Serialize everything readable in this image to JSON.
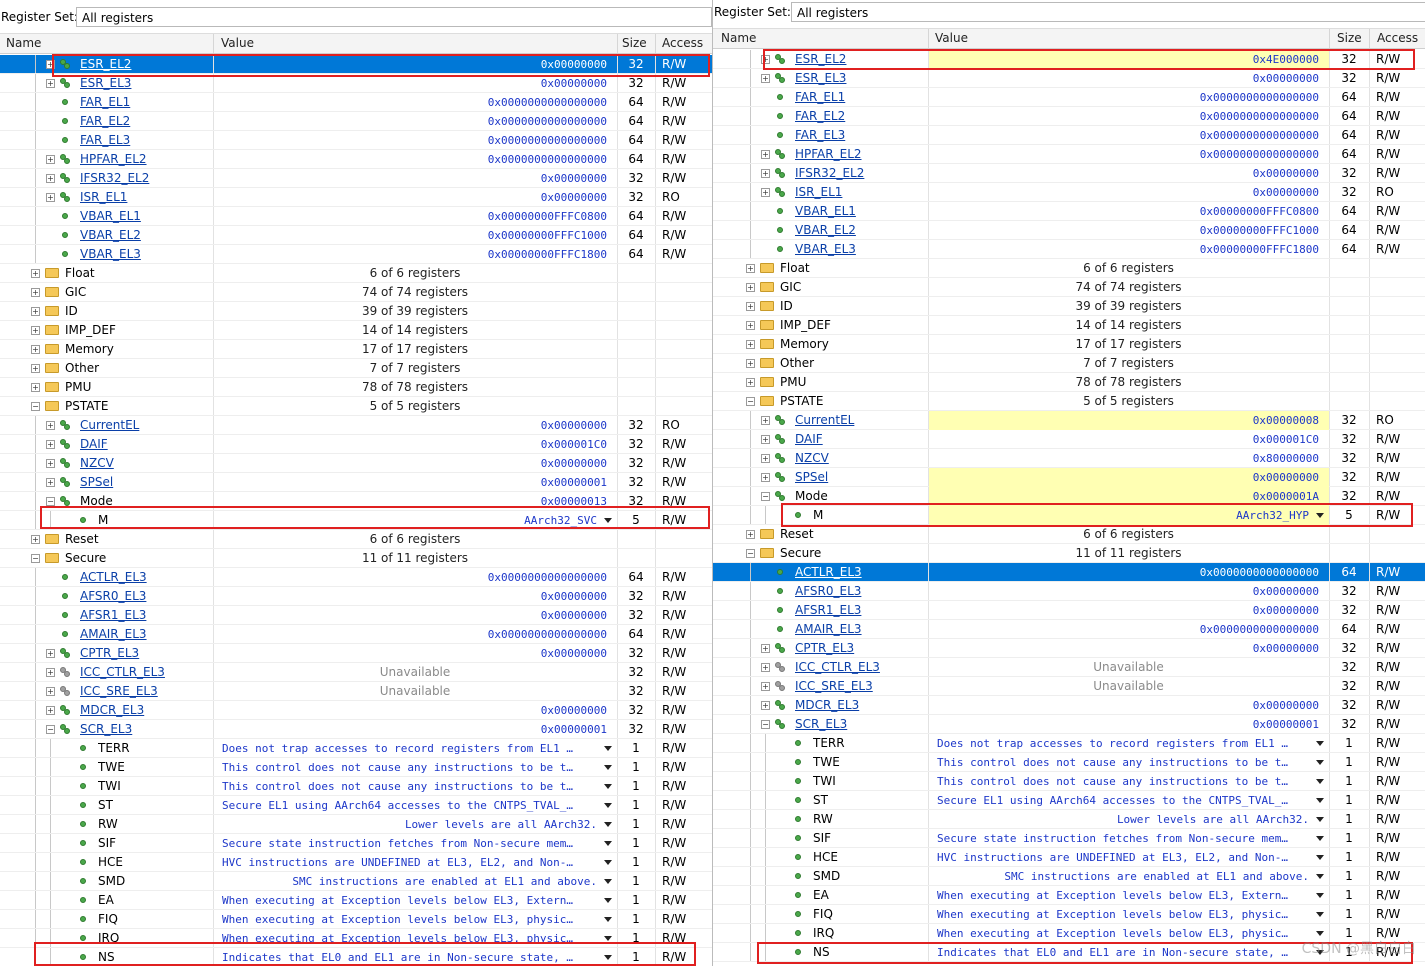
{
  "register_set_label": "Register Set:",
  "register_set_value": "All registers",
  "columns": {
    "name": "Name",
    "value": "Value",
    "size": "Size",
    "access": "Access"
  },
  "watermark": "CSDN @黑白白白",
  "left_rows": [
    {
      "name": "ESR_EL2",
      "link": true,
      "value": "0x00000000",
      "size": "32",
      "access": "R/W",
      "icon": "group",
      "exp": "+",
      "level": 2,
      "selected": true
    },
    {
      "name": "ESR_EL3",
      "link": true,
      "value": "0x00000000",
      "size": "32",
      "access": "R/W",
      "icon": "group",
      "exp": "+",
      "level": 2
    },
    {
      "name": "FAR_EL1",
      "link": true,
      "value": "0x0000000000000000",
      "size": "64",
      "access": "R/W",
      "icon": "dot",
      "level": 2
    },
    {
      "name": "FAR_EL2",
      "link": true,
      "value": "0x0000000000000000",
      "size": "64",
      "access": "R/W",
      "icon": "dot",
      "level": 2
    },
    {
      "name": "FAR_EL3",
      "link": true,
      "value": "0x0000000000000000",
      "size": "64",
      "access": "R/W",
      "icon": "dot",
      "level": 2
    },
    {
      "name": "HPFAR_EL2",
      "link": true,
      "value": "0x0000000000000000",
      "size": "64",
      "access": "R/W",
      "icon": "group",
      "exp": "+",
      "level": 2
    },
    {
      "name": "IFSR32_EL2",
      "link": true,
      "value": "0x00000000",
      "size": "32",
      "access": "R/W",
      "icon": "group",
      "exp": "+",
      "level": 2
    },
    {
      "name": "ISR_EL1",
      "link": true,
      "value": "0x00000000",
      "size": "32",
      "access": "RO",
      "icon": "group",
      "exp": "+",
      "level": 2
    },
    {
      "name": "VBAR_EL1",
      "link": true,
      "value": "0x00000000FFFC0800",
      "size": "64",
      "access": "R/W",
      "icon": "dot",
      "level": 2
    },
    {
      "name": "VBAR_EL2",
      "link": true,
      "value": "0x00000000FFFC1000",
      "size": "64",
      "access": "R/W",
      "icon": "dot",
      "level": 2
    },
    {
      "name": "VBAR_EL3",
      "link": true,
      "value": "0x00000000FFFC1800",
      "size": "64",
      "access": "R/W",
      "icon": "dot",
      "level": 2
    },
    {
      "name": "Float",
      "count": "6 of 6 registers",
      "icon": "folder",
      "exp": "+",
      "level": 1
    },
    {
      "name": "GIC",
      "count": "74 of 74 registers",
      "icon": "folder",
      "exp": "+",
      "level": 1
    },
    {
      "name": "ID",
      "count": "39 of 39 registers",
      "icon": "folder",
      "exp": "+",
      "level": 1
    },
    {
      "name": "IMP_DEF",
      "count": "14 of 14 registers",
      "icon": "folder",
      "exp": "+",
      "level": 1
    },
    {
      "name": "Memory",
      "count": "17 of 17 registers",
      "icon": "folder",
      "exp": "+",
      "level": 1
    },
    {
      "name": "Other",
      "count": "7 of 7 registers",
      "icon": "folder",
      "exp": "+",
      "level": 1
    },
    {
      "name": "PMU",
      "count": "78 of 78 registers",
      "icon": "folder",
      "exp": "+",
      "level": 1
    },
    {
      "name": "PSTATE",
      "count": "5 of 5 registers",
      "icon": "folder",
      "exp": "−",
      "level": 1
    },
    {
      "name": "CurrentEL",
      "link": true,
      "value": "0x00000000",
      "size": "32",
      "access": "RO",
      "icon": "group",
      "exp": "+",
      "level": 2
    },
    {
      "name": "DAIF",
      "link": true,
      "value": "0x000001C0",
      "size": "32",
      "access": "R/W",
      "icon": "group",
      "exp": "+",
      "level": 2
    },
    {
      "name": "NZCV",
      "link": true,
      "value": "0x00000000",
      "size": "32",
      "access": "R/W",
      "icon": "group",
      "exp": "+",
      "level": 2
    },
    {
      "name": "SPSel",
      "link": true,
      "value": "0x00000001",
      "size": "32",
      "access": "R/W",
      "icon": "group",
      "exp": "+",
      "level": 2
    },
    {
      "name": "Mode",
      "value": "0x00000013",
      "size": "32",
      "access": "R/W",
      "icon": "group",
      "exp": "−",
      "level": 2
    },
    {
      "name": "M",
      "value": "AArch32_SVC",
      "dropdown": true,
      "size": "5",
      "access": "R/W",
      "icon": "dot",
      "level": 3
    },
    {
      "name": "Reset",
      "count": "6 of 6 registers",
      "icon": "folder",
      "exp": "+",
      "level": 1
    },
    {
      "name": "Secure",
      "count": "11 of 11 registers",
      "icon": "folder",
      "exp": "−",
      "level": 1
    },
    {
      "name": "ACTLR_EL3",
      "link": true,
      "value": "0x0000000000000000",
      "size": "64",
      "access": "R/W",
      "icon": "dot",
      "level": 2
    },
    {
      "name": "AFSR0_EL3",
      "link": true,
      "value": "0x00000000",
      "size": "32",
      "access": "R/W",
      "icon": "dot",
      "level": 2
    },
    {
      "name": "AFSR1_EL3",
      "link": true,
      "value": "0x00000000",
      "size": "32",
      "access": "R/W",
      "icon": "dot",
      "level": 2
    },
    {
      "name": "AMAIR_EL3",
      "link": true,
      "value": "0x0000000000000000",
      "size": "64",
      "access": "R/W",
      "icon": "dot",
      "level": 2
    },
    {
      "name": "CPTR_EL3",
      "link": true,
      "value": "0x00000000",
      "size": "32",
      "access": "R/W",
      "icon": "group",
      "exp": "+",
      "level": 2
    },
    {
      "name": "ICC_CTLR_EL3",
      "link": true,
      "unavailable": "Unavailable",
      "size": "32",
      "access": "R/W",
      "icon": "greygroup",
      "exp": "+",
      "level": 2
    },
    {
      "name": "ICC_SRE_EL3",
      "link": true,
      "unavailable": "Unavailable",
      "size": "32",
      "access": "R/W",
      "icon": "greygroup",
      "exp": "+",
      "level": 2
    },
    {
      "name": "MDCR_EL3",
      "link": true,
      "value": "0x00000000",
      "size": "32",
      "access": "R/W",
      "icon": "group",
      "exp": "+",
      "level": 2
    },
    {
      "name": "SCR_EL3",
      "link": true,
      "value": "0x00000001",
      "size": "32",
      "access": "R/W",
      "icon": "group",
      "exp": "−",
      "level": 2
    },
    {
      "name": "TERR",
      "text": "Does not trap accesses to record registers from EL1 …",
      "dropdown": true,
      "size": "1",
      "access": "R/W",
      "icon": "dot",
      "level": 3
    },
    {
      "name": "TWE",
      "text": "This control does not cause any instructions to be t…",
      "dropdown": true,
      "size": "1",
      "access": "R/W",
      "icon": "dot",
      "level": 3
    },
    {
      "name": "TWI",
      "text": "This control does not cause any instructions to be t…",
      "dropdown": true,
      "size": "1",
      "access": "R/W",
      "icon": "dot",
      "level": 3
    },
    {
      "name": "ST",
      "text": "Secure EL1 using AArch64 accesses to the CNTPS_TVAL_…",
      "dropdown": true,
      "size": "1",
      "access": "R/W",
      "icon": "dot",
      "level": 3
    },
    {
      "name": "RW",
      "value": "Lower levels are all AArch32.",
      "dropdown": true,
      "size": "1",
      "access": "R/W",
      "icon": "dot",
      "level": 3
    },
    {
      "name": "SIF",
      "text": "Secure state instruction fetches from Non-secure mem…",
      "dropdown": true,
      "size": "1",
      "access": "R/W",
      "icon": "dot",
      "level": 3
    },
    {
      "name": "HCE",
      "text": "HVC instructions are UNDEFINED at EL3, EL2, and Non-…",
      "dropdown": true,
      "size": "1",
      "access": "R/W",
      "icon": "dot",
      "level": 3
    },
    {
      "name": "SMD",
      "value": "SMC instructions are enabled at EL1 and above.",
      "dropdown": true,
      "size": "1",
      "access": "R/W",
      "icon": "dot",
      "level": 3
    },
    {
      "name": "EA",
      "text": "When executing at Exception levels below EL3, Extern…",
      "dropdown": true,
      "size": "1",
      "access": "R/W",
      "icon": "dot",
      "level": 3
    },
    {
      "name": "FIQ",
      "text": "When executing at Exception levels below EL3, physic…",
      "dropdown": true,
      "size": "1",
      "access": "R/W",
      "icon": "dot",
      "level": 3
    },
    {
      "name": "IRQ",
      "text": "When executing at Exception levels below EL3, physic…",
      "dropdown": true,
      "size": "1",
      "access": "R/W",
      "icon": "dot",
      "level": 3
    },
    {
      "name": "NS",
      "text": "Indicates that EL0 and EL1 are in Non-secure state, …",
      "dropdown": true,
      "size": "1",
      "access": "R/W",
      "icon": "dot",
      "level": 3
    }
  ],
  "right_rows": [
    {
      "name": "ESR_EL2",
      "link": true,
      "value": "0x4E000000",
      "size": "32",
      "access": "R/W",
      "icon": "group",
      "exp": "+",
      "level": 2,
      "changed": true
    },
    {
      "name": "ESR_EL3",
      "link": true,
      "value": "0x00000000",
      "size": "32",
      "access": "R/W",
      "icon": "group",
      "exp": "+",
      "level": 2
    },
    {
      "name": "FAR_EL1",
      "link": true,
      "value": "0x0000000000000000",
      "size": "64",
      "access": "R/W",
      "icon": "dot",
      "level": 2
    },
    {
      "name": "FAR_EL2",
      "link": true,
      "value": "0x0000000000000000",
      "size": "64",
      "access": "R/W",
      "icon": "dot",
      "level": 2
    },
    {
      "name": "FAR_EL3",
      "link": true,
      "value": "0x0000000000000000",
      "size": "64",
      "access": "R/W",
      "icon": "dot",
      "level": 2
    },
    {
      "name": "HPFAR_EL2",
      "link": true,
      "value": "0x0000000000000000",
      "size": "64",
      "access": "R/W",
      "icon": "group",
      "exp": "+",
      "level": 2
    },
    {
      "name": "IFSR32_EL2",
      "link": true,
      "value": "0x00000000",
      "size": "32",
      "access": "R/W",
      "icon": "group",
      "exp": "+",
      "level": 2
    },
    {
      "name": "ISR_EL1",
      "link": true,
      "value": "0x00000000",
      "size": "32",
      "access": "RO",
      "icon": "group",
      "exp": "+",
      "level": 2
    },
    {
      "name": "VBAR_EL1",
      "link": true,
      "value": "0x00000000FFFC0800",
      "size": "64",
      "access": "R/W",
      "icon": "dot",
      "level": 2
    },
    {
      "name": "VBAR_EL2",
      "link": true,
      "value": "0x00000000FFFC1000",
      "size": "64",
      "access": "R/W",
      "icon": "dot",
      "level": 2
    },
    {
      "name": "VBAR_EL3",
      "link": true,
      "value": "0x00000000FFFC1800",
      "size": "64",
      "access": "R/W",
      "icon": "dot",
      "level": 2
    },
    {
      "name": "Float",
      "count": "6 of 6 registers",
      "icon": "folder",
      "exp": "+",
      "level": 1
    },
    {
      "name": "GIC",
      "count": "74 of 74 registers",
      "icon": "folder",
      "exp": "+",
      "level": 1
    },
    {
      "name": "ID",
      "count": "39 of 39 registers",
      "icon": "folder",
      "exp": "+",
      "level": 1
    },
    {
      "name": "IMP_DEF",
      "count": "14 of 14 registers",
      "icon": "folder",
      "exp": "+",
      "level": 1
    },
    {
      "name": "Memory",
      "count": "17 of 17 registers",
      "icon": "folder",
      "exp": "+",
      "level": 1
    },
    {
      "name": "Other",
      "count": "7 of 7 registers",
      "icon": "folder",
      "exp": "+",
      "level": 1
    },
    {
      "name": "PMU",
      "count": "78 of 78 registers",
      "icon": "folder",
      "exp": "+",
      "level": 1
    },
    {
      "name": "PSTATE",
      "count": "5 of 5 registers",
      "icon": "folder",
      "exp": "−",
      "level": 1
    },
    {
      "name": "CurrentEL",
      "link": true,
      "value": "0x00000008",
      "size": "32",
      "access": "RO",
      "icon": "group",
      "exp": "+",
      "level": 2,
      "changed": true
    },
    {
      "name": "DAIF",
      "link": true,
      "value": "0x000001C0",
      "size": "32",
      "access": "R/W",
      "icon": "group",
      "exp": "+",
      "level": 2
    },
    {
      "name": "NZCV",
      "link": true,
      "value": "0x80000000",
      "size": "32",
      "access": "R/W",
      "icon": "group",
      "exp": "+",
      "level": 2
    },
    {
      "name": "SPSel",
      "link": true,
      "value": "0x00000000",
      "size": "32",
      "access": "R/W",
      "icon": "group",
      "exp": "+",
      "level": 2,
      "changed": true
    },
    {
      "name": "Mode",
      "value": "0x0000001A",
      "size": "32",
      "access": "R/W",
      "icon": "group",
      "exp": "−",
      "level": 2,
      "changed": true
    },
    {
      "name": "M",
      "value": "AArch32_HYP",
      "dropdown": true,
      "size": "5",
      "access": "R/W",
      "icon": "dot",
      "level": 3,
      "changed": true
    },
    {
      "name": "Reset",
      "count": "6 of 6 registers",
      "icon": "folder",
      "exp": "+",
      "level": 1
    },
    {
      "name": "Secure",
      "count": "11 of 11 registers",
      "icon": "folder",
      "exp": "−",
      "level": 1
    },
    {
      "name": "ACTLR_EL3",
      "link": true,
      "value": "0x0000000000000000",
      "size": "64",
      "access": "R/W",
      "icon": "dot",
      "level": 2,
      "selected": true
    },
    {
      "name": "AFSR0_EL3",
      "link": true,
      "value": "0x00000000",
      "size": "32",
      "access": "R/W",
      "icon": "dot",
      "level": 2
    },
    {
      "name": "AFSR1_EL3",
      "link": true,
      "value": "0x00000000",
      "size": "32",
      "access": "R/W",
      "icon": "dot",
      "level": 2
    },
    {
      "name": "AMAIR_EL3",
      "link": true,
      "value": "0x0000000000000000",
      "size": "64",
      "access": "R/W",
      "icon": "dot",
      "level": 2
    },
    {
      "name": "CPTR_EL3",
      "link": true,
      "value": "0x00000000",
      "size": "32",
      "access": "R/W",
      "icon": "group",
      "exp": "+",
      "level": 2
    },
    {
      "name": "ICC_CTLR_EL3",
      "link": true,
      "unavailable": "Unavailable",
      "size": "32",
      "access": "R/W",
      "icon": "greygroup",
      "exp": "+",
      "level": 2
    },
    {
      "name": "ICC_SRE_EL3",
      "link": true,
      "unavailable": "Unavailable",
      "size": "32",
      "access": "R/W",
      "icon": "greygroup",
      "exp": "+",
      "level": 2
    },
    {
      "name": "MDCR_EL3",
      "link": true,
      "value": "0x00000000",
      "size": "32",
      "access": "R/W",
      "icon": "group",
      "exp": "+",
      "level": 2
    },
    {
      "name": "SCR_EL3",
      "link": true,
      "value": "0x00000001",
      "size": "32",
      "access": "R/W",
      "icon": "group",
      "exp": "−",
      "level": 2
    },
    {
      "name": "TERR",
      "text": "Does not trap accesses to record registers from EL1 …",
      "dropdown": true,
      "size": "1",
      "access": "R/W",
      "icon": "dot",
      "level": 3
    },
    {
      "name": "TWE",
      "text": "This control does not cause any instructions to be t…",
      "dropdown": true,
      "size": "1",
      "access": "R/W",
      "icon": "dot",
      "level": 3
    },
    {
      "name": "TWI",
      "text": "This control does not cause any instructions to be t…",
      "dropdown": true,
      "size": "1",
      "access": "R/W",
      "icon": "dot",
      "level": 3
    },
    {
      "name": "ST",
      "text": "Secure EL1 using AArch64 accesses to the CNTPS_TVAL_…",
      "dropdown": true,
      "size": "1",
      "access": "R/W",
      "icon": "dot",
      "level": 3
    },
    {
      "name": "RW",
      "value": "Lower levels are all AArch32.",
      "dropdown": true,
      "size": "1",
      "access": "R/W",
      "icon": "dot",
      "level": 3
    },
    {
      "name": "SIF",
      "text": "Secure state instruction fetches from Non-secure mem…",
      "dropdown": true,
      "size": "1",
      "access": "R/W",
      "icon": "dot",
      "level": 3
    },
    {
      "name": "HCE",
      "text": "HVC instructions are UNDEFINED at EL3, EL2, and Non-…",
      "dropdown": true,
      "size": "1",
      "access": "R/W",
      "icon": "dot",
      "level": 3
    },
    {
      "name": "SMD",
      "value": "SMC instructions are enabled at EL1 and above.",
      "dropdown": true,
      "size": "1",
      "access": "R/W",
      "icon": "dot",
      "level": 3
    },
    {
      "name": "EA",
      "text": "When executing at Exception levels below EL3, Extern…",
      "dropdown": true,
      "size": "1",
      "access": "R/W",
      "icon": "dot",
      "level": 3
    },
    {
      "name": "FIQ",
      "text": "When executing at Exception levels below EL3, physic…",
      "dropdown": true,
      "size": "1",
      "access": "R/W",
      "icon": "dot",
      "level": 3
    },
    {
      "name": "IRQ",
      "text": "When executing at Exception levels below EL3, physic…",
      "dropdown": true,
      "size": "1",
      "access": "R/W",
      "icon": "dot",
      "level": 3
    },
    {
      "name": "NS",
      "text": "Indicates that EL0 and EL1 are in Non-secure state, …",
      "dropdown": true,
      "size": "1",
      "access": "R/W",
      "icon": "dot",
      "level": 3
    }
  ]
}
